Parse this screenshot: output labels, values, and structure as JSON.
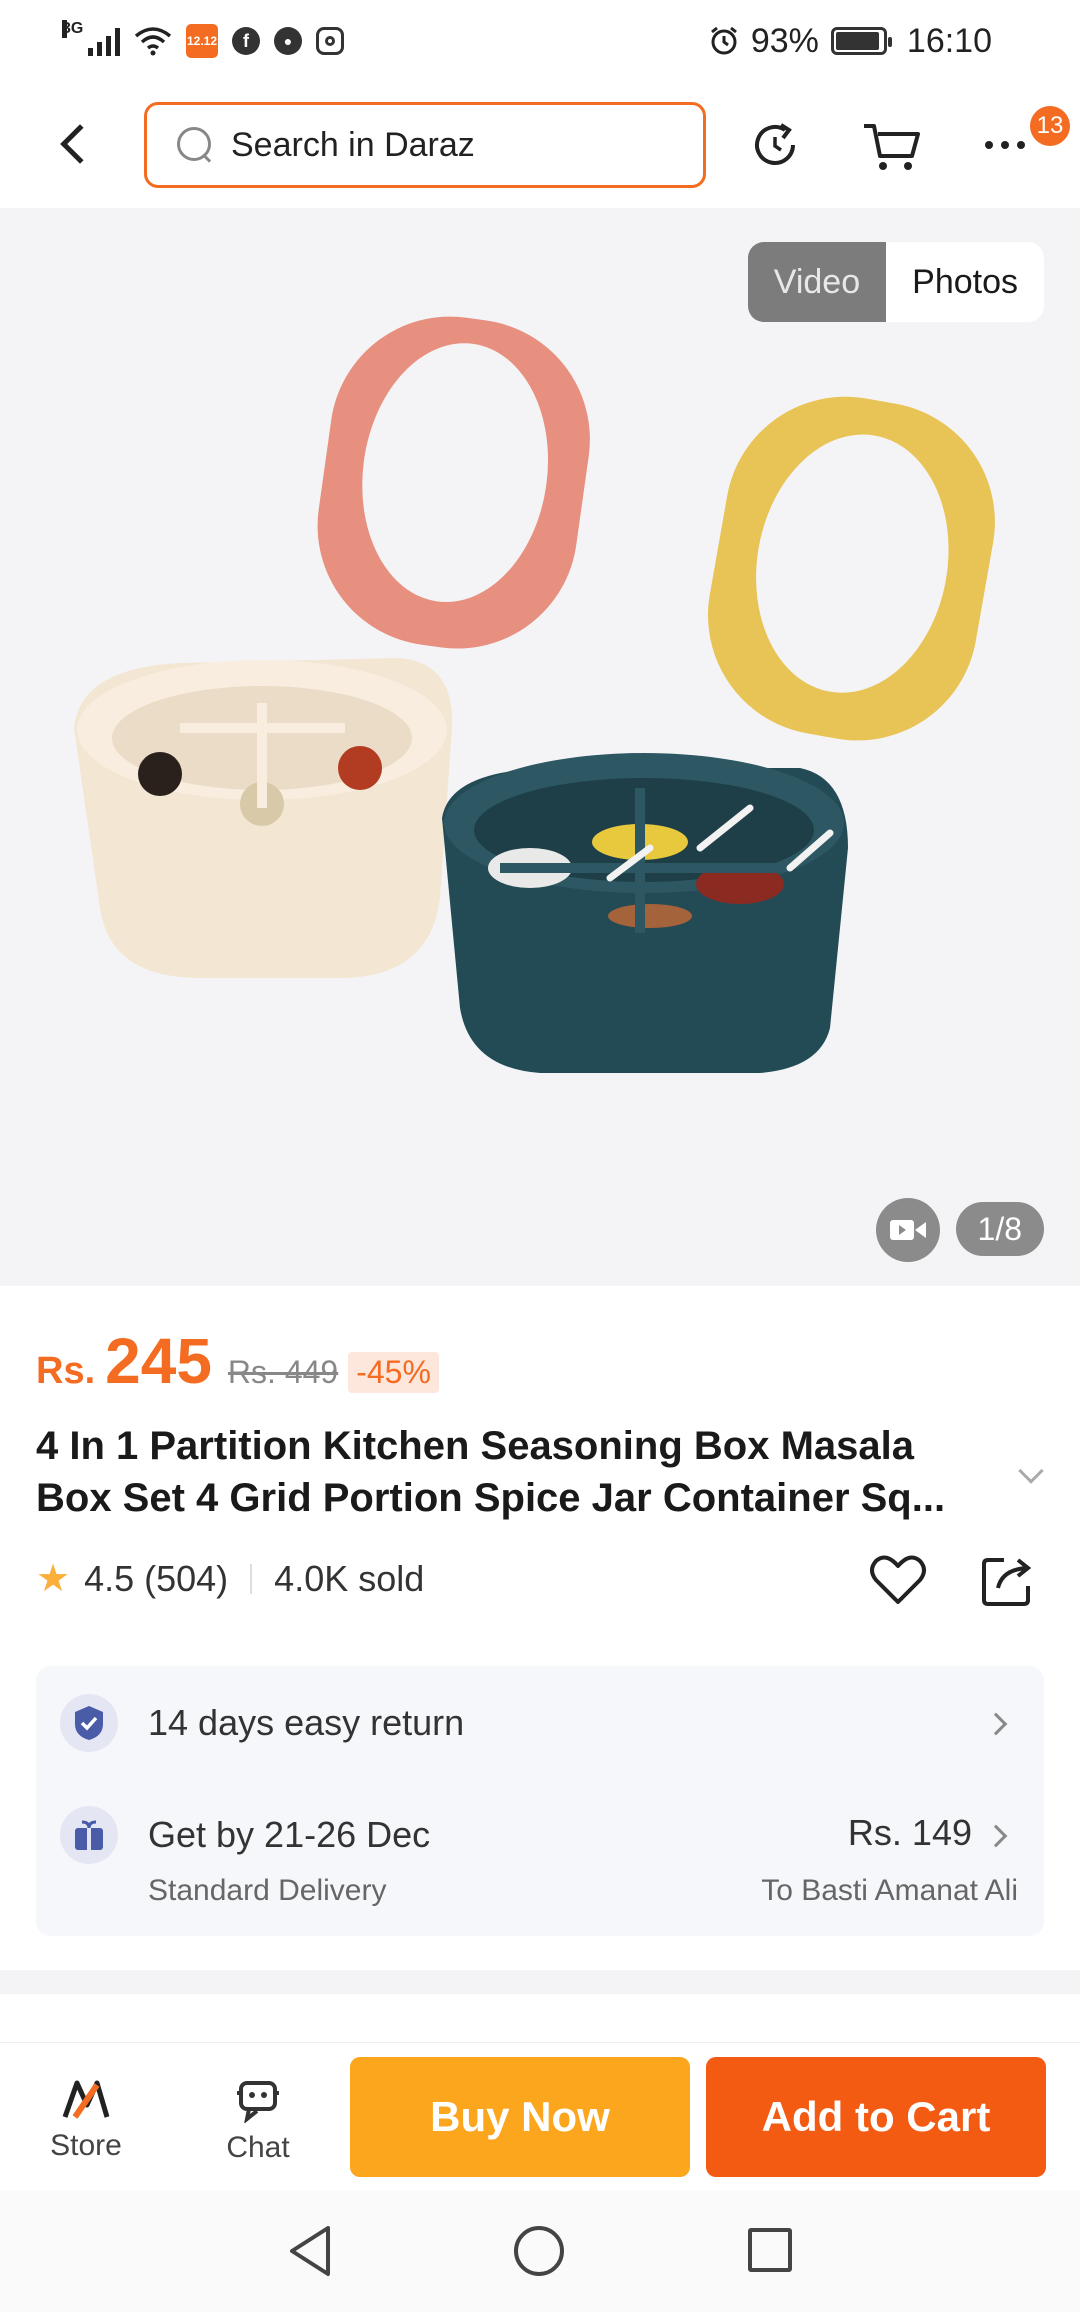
{
  "status_bar": {
    "network": "3G",
    "app_badge": "12.12",
    "battery": "93%",
    "time": "16:10"
  },
  "top_nav": {
    "search_placeholder": "Search in Daraz",
    "more_badge": "13"
  },
  "gallery": {
    "video_label": "Video",
    "photos_label": "Photos",
    "page_indicator": "1/8"
  },
  "product": {
    "currency": "Rs.",
    "price": "245",
    "original_price": "Rs. 449",
    "discount": "-45%",
    "title": "4 In 1 Partition Kitchen Seasoning Box Masala Box Set 4 Grid Portion Spice Jar Container Sq...",
    "rating": "4.5",
    "reviews": "(504)",
    "sold": "4.0K sold"
  },
  "services": {
    "return_label": "14 days easy return",
    "delivery_label": "Get by 21-26 Dec",
    "delivery_sub": "Standard Delivery",
    "shipping_price": "Rs. 149",
    "delivery_to": "To Basti Amanat Ali"
  },
  "action_bar": {
    "store_label": "Store",
    "chat_label": "Chat",
    "buy_now_label": "Buy Now",
    "add_to_cart_label": "Add to Cart"
  },
  "colors": {
    "accent": "#f36c21",
    "buy_now": "#fba61c",
    "add_to_cart": "#f35a12",
    "star": "#fbb03b"
  }
}
